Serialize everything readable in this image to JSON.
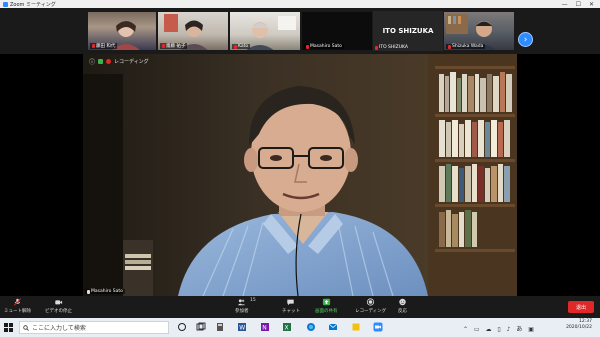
{
  "window": {
    "title": "Zoom ミーティング"
  },
  "gallery": {
    "participants": [
      {
        "name": "藤田 和代"
      },
      {
        "name": "齋藤 祐子"
      },
      {
        "name": "Kato"
      },
      {
        "name": "Masahiro Sato"
      },
      {
        "name": "ITO SHIZUKA",
        "display_name": "ITO SHIZUKA"
      },
      {
        "name": "Shizuka Wada"
      }
    ],
    "next_label": "›"
  },
  "main": {
    "top_info": "レコーディング",
    "speaker": "Masahiro Sato"
  },
  "toolbar": {
    "items": [
      {
        "label": "ミュート解除"
      },
      {
        "label": "ビデオの停止"
      },
      {
        "label": "参加者",
        "count": "15"
      },
      {
        "label": "チャット"
      },
      {
        "label": "画面の共有"
      },
      {
        "label": "レコーディング"
      },
      {
        "label": "反応"
      }
    ],
    "end_label": "退出"
  },
  "taskbar": {
    "search_placeholder": "ここに入力して検索",
    "time": "12:37",
    "date": "2020/10/22"
  }
}
